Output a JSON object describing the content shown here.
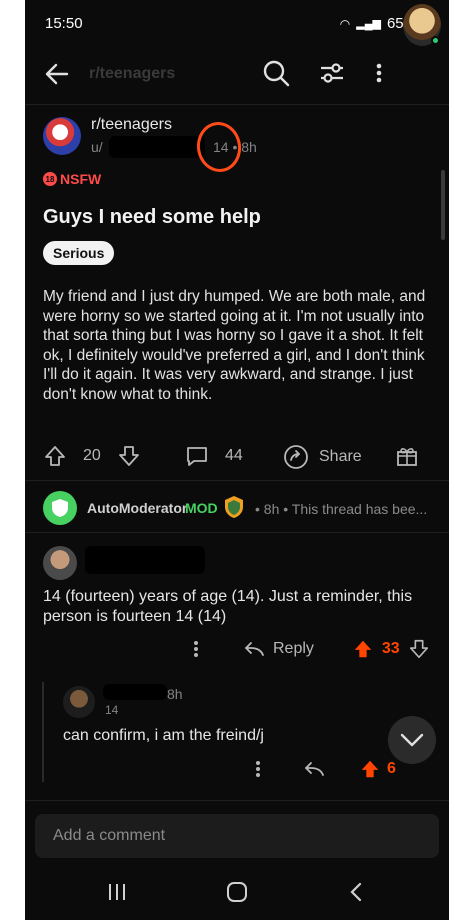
{
  "status_bar": {
    "time": "15:50",
    "battery": "65%"
  },
  "header": {
    "subreddit_name": "r/teenagers"
  },
  "post": {
    "subreddit": "r/teenagers",
    "author_prefix": "u/",
    "author_age": "14",
    "age": "8h",
    "nsfw_label": "NSFW",
    "title": "Guys I need some help",
    "flair": "Serious",
    "body": "My friend and I just dry humped. We are both male, and were horny so we started going at it. I'm not usually into that sorta thing but I was horny so I gave it a shot. It felt ok, I definitely would've preferred a girl, and I don't think I'll do it again. It was very awkward, and strange. I just don't know what to think.",
    "upvotes": "20",
    "comments": "44",
    "share_label": "Share"
  },
  "automod": {
    "name": "AutoModerator",
    "mod_tag": "MOD",
    "meta": "• 8h • This thread has bee..."
  },
  "comment1": {
    "text": "14 (fourteen) years of age (14). Just a reminder, this person is fourteen 14 (14)",
    "reply_label": "Reply",
    "score": "33"
  },
  "comment2": {
    "age": "8h",
    "sub": "14",
    "text": "can confirm, i am the freind/j",
    "score": "6"
  },
  "comment_input": {
    "placeholder": "Add a comment"
  },
  "colors": {
    "accent": "#ff4500",
    "mod_green": "#46d160",
    "background": "#0b0b0b"
  }
}
